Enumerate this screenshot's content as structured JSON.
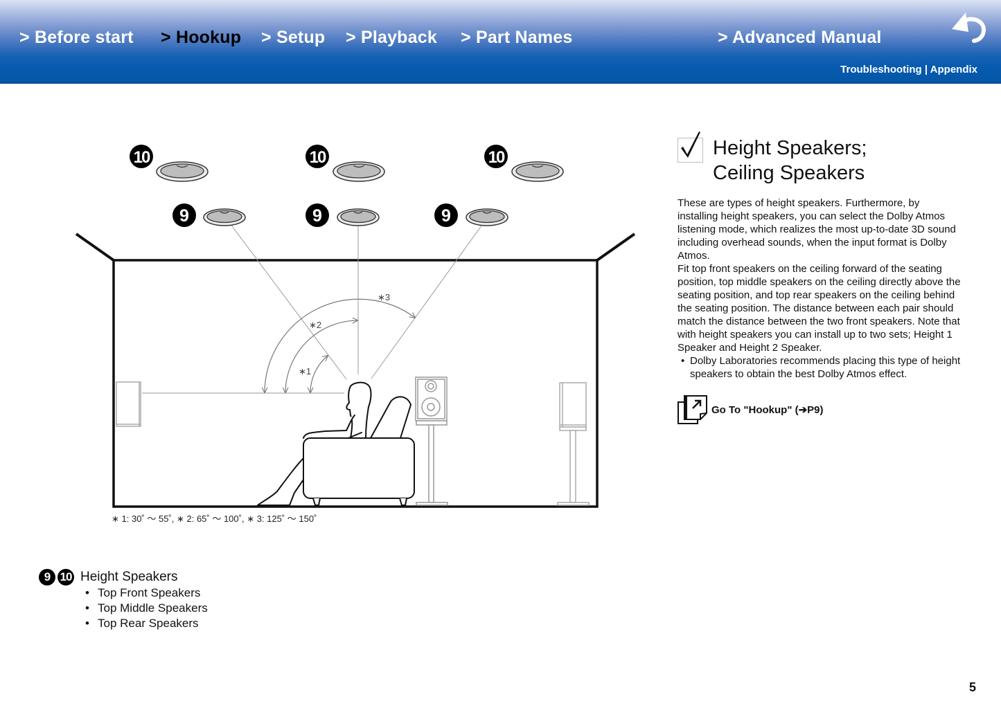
{
  "header": {
    "nav": [
      {
        "label": "> Before start",
        "active": false
      },
      {
        "label": "> Hookup",
        "active": true
      },
      {
        "label": "> Setup",
        "active": false
      },
      {
        "label": "> Playback",
        "active": false
      },
      {
        "label": "> Part Names",
        "active": false
      },
      {
        "label": "> Advanced Manual",
        "active": false
      }
    ],
    "sub_links": {
      "troubleshooting": "Troubleshooting",
      "separator": " | ",
      "appendix": "Appendix"
    },
    "back_icon": "back-arrow-icon",
    "colors": {
      "gradient_top": "#dbe3f5",
      "gradient_bottom": "#0556a6",
      "active_text": "#000000",
      "text": "#ffffff"
    }
  },
  "diagram": {
    "ceiling_labels": [
      {
        "number": "10",
        "type": "top-rear"
      },
      {
        "number": "10",
        "type": "top-middle"
      },
      {
        "number": "10",
        "type": "top-front"
      },
      {
        "number": "9",
        "type": "top-rear"
      },
      {
        "number": "9",
        "type": "top-middle"
      },
      {
        "number": "9",
        "type": "top-front"
      }
    ],
    "angle_labels": [
      "∗1",
      "∗2",
      "∗3"
    ],
    "footnote": "∗ 1: 30˚ 〜 55˚, ∗ 2: 65˚ 〜 100˚, ∗ 3: 125˚ 〜 150˚"
  },
  "legend": {
    "badges": [
      "9",
      "10"
    ],
    "title": "Height Speakers",
    "items": [
      "Top Front Speakers",
      "Top Middle Speakers",
      "Top Rear Speakers"
    ]
  },
  "section": {
    "icon": "checkmark-box-icon",
    "title_line1": "Height Speakers;",
    "title_line2": "Ceiling Speakers",
    "paragraphs": [
      "These are types of height speakers. Furthermore, by installing height speakers, you can select the Dolby Atmos listening mode, which realizes the most up-to-date 3D sound including overhead sounds, when the input format is Dolby Atmos.",
      "Fit top front speakers on the ceiling forward of the seating position, top middle speakers on the ceiling directly above the seating position, and top rear speakers on the ceiling behind the seating position. The distance between each pair should match the distance between the two front speakers. Note that with height speakers you can install up to two sets; Height 1 Speaker and Height 2 Speaker."
    ],
    "bullet": "Dolby Laboratories recommends placing this type of height speakers to obtain the best Dolby Atmos effect.",
    "goto_link": "Go To \"Hookup\" (➔P9)"
  },
  "page_number": "5"
}
